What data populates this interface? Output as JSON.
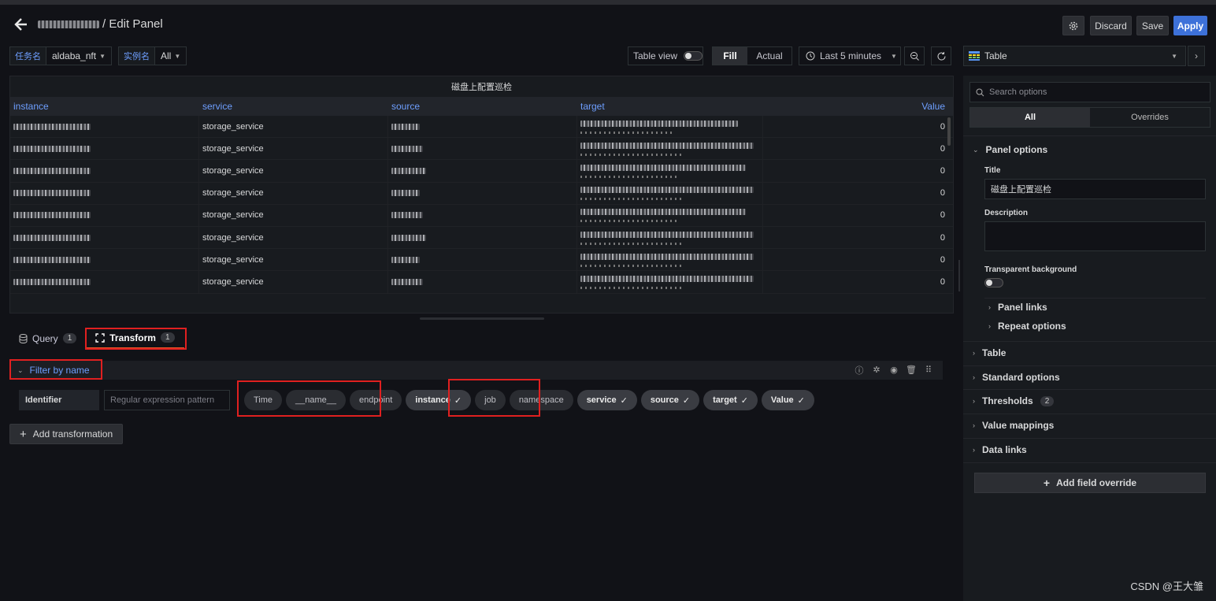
{
  "header": {
    "title_suffix": "/ Edit Panel",
    "settings_icon": "gear-icon",
    "discard_label": "Discard",
    "save_label": "Save",
    "apply_label": "Apply",
    "apply_color": "#3d71d9"
  },
  "variables": [
    {
      "label": "任务名",
      "value": "aldaba_nft"
    },
    {
      "label": "实例名",
      "value": "All"
    }
  ],
  "toolbar": {
    "table_view_label": "Table view",
    "fill_label": "Fill",
    "actual_label": "Actual",
    "time_range": "Last 5 minutes"
  },
  "panel": {
    "title": "磁盘上配置巡检",
    "columns": [
      "instance",
      "service",
      "source",
      "target",
      "Value"
    ],
    "rows": [
      {
        "service": "storage_service",
        "value": "0"
      },
      {
        "service": "storage_service",
        "value": "0"
      },
      {
        "service": "storage_service",
        "value": "0"
      },
      {
        "service": "storage_service",
        "value": "0"
      },
      {
        "service": "storage_service",
        "value": "0"
      },
      {
        "service": "storage_service",
        "value": "0"
      },
      {
        "service": "storage_service",
        "value": "0"
      },
      {
        "service": "storage_service",
        "value": "0"
      }
    ]
  },
  "tabs": {
    "query_label": "Query",
    "query_count": "1",
    "transform_label": "Transform",
    "transform_count": "1"
  },
  "transform": {
    "name": "Filter by name",
    "identifier_label": "Identifier",
    "regex_placeholder": "Regular expression pattern",
    "fields": [
      {
        "label": "Time",
        "selected": false
      },
      {
        "label": "__name__",
        "selected": false
      },
      {
        "label": "endpoint",
        "selected": false
      },
      {
        "label": "instance",
        "selected": true
      },
      {
        "label": "job",
        "selected": false
      },
      {
        "label": "namespace",
        "selected": false
      },
      {
        "label": "service",
        "selected": true
      },
      {
        "label": "source",
        "selected": true
      },
      {
        "label": "target",
        "selected": true
      },
      {
        "label": "Value",
        "selected": true
      }
    ],
    "add_label": "Add transformation"
  },
  "options": {
    "viz_name": "Table",
    "search_placeholder": "Search options",
    "tab_all": "All",
    "tab_overrides": "Overrides",
    "panel_options_label": "Panel options",
    "title_label": "Title",
    "title_value": "磁盘上配置巡检",
    "description_label": "Description",
    "transparent_label": "Transparent background",
    "panel_links_label": "Panel links",
    "repeat_options_label": "Repeat options",
    "table_label": "Table",
    "standard_options_label": "Standard options",
    "thresholds_label": "Thresholds",
    "thresholds_count": "2",
    "value_mappings_label": "Value mappings",
    "data_links_label": "Data links",
    "add_override_label": "Add field override"
  },
  "watermark": "CSDN @王大雏",
  "colors": {
    "accent": "#6e9fff",
    "highlight_box": "#e02020",
    "active_tab": "#f05a28"
  }
}
